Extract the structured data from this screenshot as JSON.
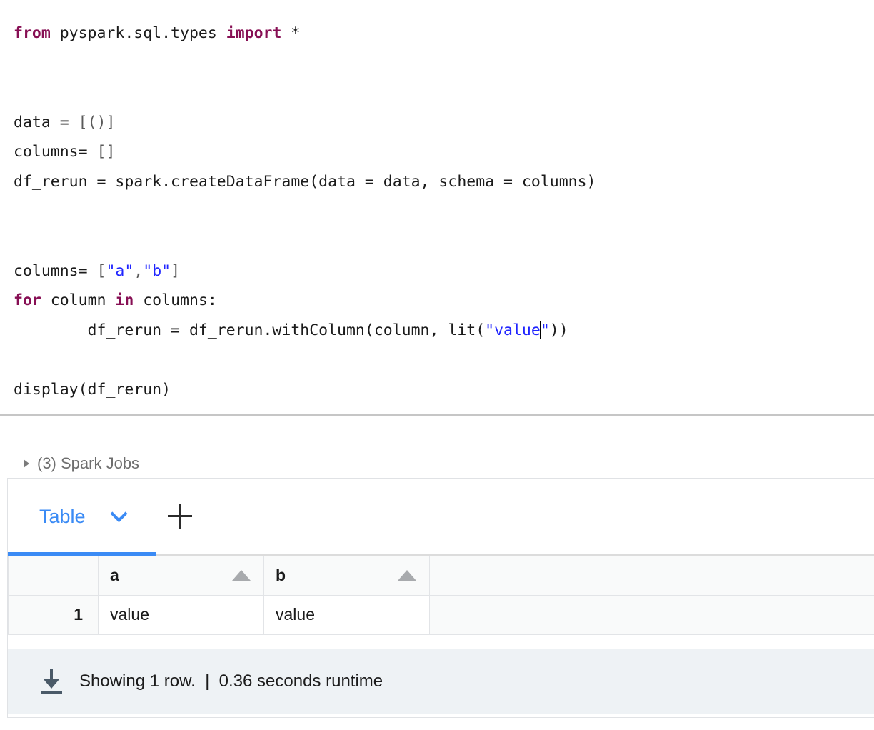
{
  "code_cell": {
    "language": "python",
    "lines": [
      {
        "id": "l1",
        "indent": 0,
        "tokens": [
          {
            "t": "from",
            "cls": "kw"
          },
          {
            "t": " pyspark.sql.types ",
            "cls": "plain"
          },
          {
            "t": "import",
            "cls": "kw"
          },
          {
            "t": " *",
            "cls": "plain"
          }
        ]
      },
      {
        "id": "l2",
        "indent": 0,
        "tokens": []
      },
      {
        "id": "l3",
        "indent": 0,
        "tokens": []
      },
      {
        "id": "l4",
        "indent": 0,
        "tokens": [
          {
            "t": "data = ",
            "cls": "plain"
          },
          {
            "t": "[()]",
            "cls": "punct"
          }
        ]
      },
      {
        "id": "l5",
        "indent": 0,
        "tokens": [
          {
            "t": "columns= ",
            "cls": "plain"
          },
          {
            "t": "[]",
            "cls": "punct"
          }
        ]
      },
      {
        "id": "l6",
        "indent": 0,
        "tokens": [
          {
            "t": "df_rerun = spark.createDataFrame(data = data, schema = columns)",
            "cls": "plain"
          }
        ]
      },
      {
        "id": "l7",
        "indent": 0,
        "tokens": []
      },
      {
        "id": "l8",
        "indent": 0,
        "tokens": []
      },
      {
        "id": "l9",
        "indent": 0,
        "tokens": [
          {
            "t": "columns= ",
            "cls": "plain"
          },
          {
            "t": "[",
            "cls": "punct"
          },
          {
            "t": "\"a\"",
            "cls": "str"
          },
          {
            "t": ",",
            "cls": "punct"
          },
          {
            "t": "\"b\"",
            "cls": "str"
          },
          {
            "t": "]",
            "cls": "punct"
          }
        ]
      },
      {
        "id": "l10",
        "indent": 0,
        "tokens": [
          {
            "t": "for",
            "cls": "kw"
          },
          {
            "t": " column ",
            "cls": "plain"
          },
          {
            "t": "in",
            "cls": "kw"
          },
          {
            "t": " columns:",
            "cls": "plain"
          }
        ]
      },
      {
        "id": "l11",
        "indent": 0,
        "tokens": [
          {
            "t": "        df_rerun = df_rerun.withColumn(column, lit(",
            "cls": "plain"
          },
          {
            "t": "\"value",
            "cls": "str"
          },
          {
            "t": "",
            "cls": "caret"
          },
          {
            "t": "\"",
            "cls": "str"
          },
          {
            "t": "))",
            "cls": "plain"
          }
        ]
      },
      {
        "id": "l12",
        "indent": 0,
        "tokens": []
      },
      {
        "id": "l13",
        "indent": 0,
        "tokens": [
          {
            "t": "display(df_rerun)",
            "cls": "plain"
          }
        ]
      }
    ],
    "plain_text": "from pyspark.sql.types import *\n\n\ndata = [()]\ncolumns= []\ndf_rerun = spark.createDataFrame(data = data, schema = columns)\n\n\ncolumns= [\"a\",\"b\"]\nfor column in columns:\n        df_rerun = df_rerun.withColumn(column, lit(\"value\"))\n\ndisplay(df_rerun)"
  },
  "spark_jobs": {
    "expander_icon": "triangle-right-icon",
    "label": "(3) Spark Jobs",
    "count": 3,
    "expanded": false
  },
  "results": {
    "tabs": [
      {
        "label": "Table",
        "active": true,
        "dropdown_icon": "chevron-down-icon"
      }
    ],
    "add_tab_icon": "plus-icon",
    "table": {
      "index_header": "",
      "columns": [
        {
          "name": "a",
          "sort_icon": "sort-ascending-arrow-icon"
        },
        {
          "name": "b",
          "sort_icon": "sort-ascending-arrow-icon"
        }
      ],
      "rows": [
        {
          "index": "1",
          "cells": [
            "value",
            "value"
          ]
        }
      ]
    },
    "footer": {
      "download_icon": "download-icon",
      "status": "Showing 1 row.  |  0.36 seconds runtime",
      "rows_shown": 1,
      "runtime_seconds": "0.36"
    }
  },
  "colors": {
    "keyword": "#870f54",
    "string": "#1f24ff",
    "plain_code": "#1b1b1b",
    "accent_blue": "#3b8bf5",
    "muted_text": "#6e6e6e",
    "footer_bg": "#eef2f5",
    "table_header_bg": "#f9fafa",
    "border": "#e2e4e7",
    "download_icon": "#4a5a68"
  }
}
